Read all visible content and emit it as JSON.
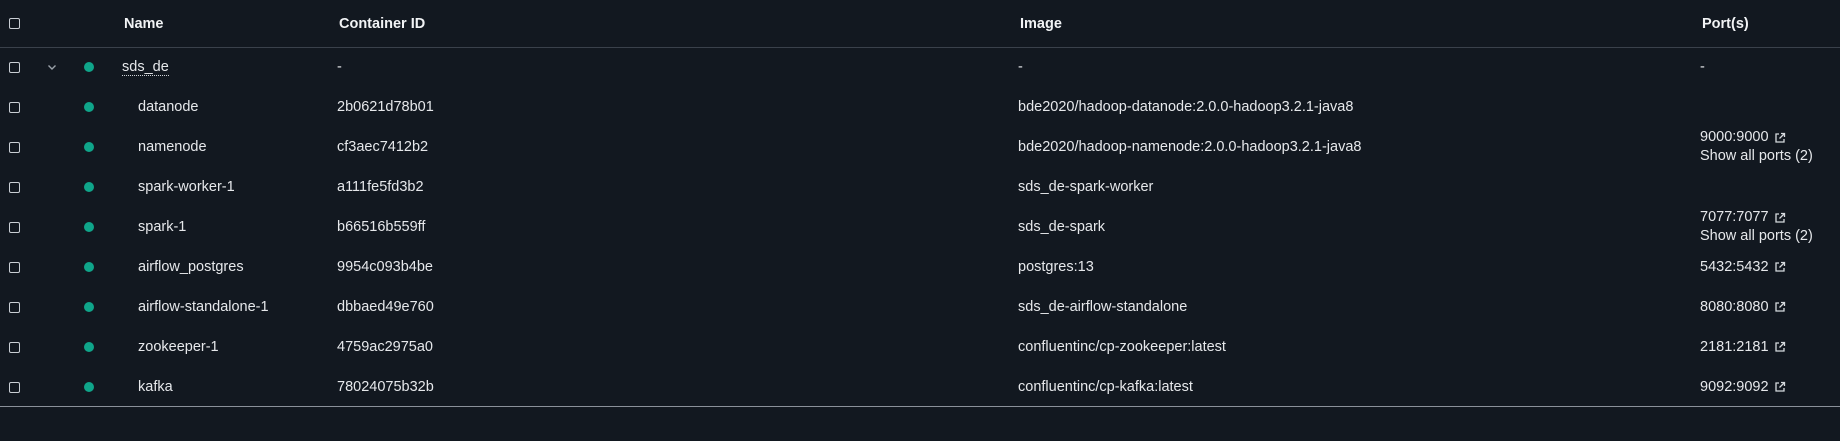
{
  "columns": {
    "name": "Name",
    "container_id": "Container ID",
    "image": "Image",
    "ports": "Port(s)"
  },
  "group": {
    "name": "sds_de",
    "container_id": "-",
    "image": "-",
    "ports": "-"
  },
  "rows": [
    {
      "name": "datanode",
      "container_id": "2b0621d78b01",
      "image": "bde2020/hadoop-datanode:2.0.0-hadoop3.2.1-java8",
      "port": "",
      "show_all": ""
    },
    {
      "name": "namenode",
      "container_id": "cf3aec7412b2",
      "image": "bde2020/hadoop-namenode:2.0.0-hadoop3.2.1-java8",
      "port": "9000:9000",
      "show_all": "Show all ports (2)"
    },
    {
      "name": "spark-worker-1",
      "container_id": "a111fe5fd3b2",
      "image": "sds_de-spark-worker",
      "port": "",
      "show_all": ""
    },
    {
      "name": "spark-1",
      "container_id": "b66516b559ff",
      "image": "sds_de-spark",
      "port": "7077:7077",
      "show_all": "Show all ports (2)"
    },
    {
      "name": "airflow_postgres",
      "container_id": "9954c093b4be",
      "image": "postgres:13",
      "port": "5432:5432",
      "show_all": ""
    },
    {
      "name": "airflow-standalone-1",
      "container_id": "dbbaed49e760",
      "image": "sds_de-airflow-standalone",
      "port": "8080:8080",
      "show_all": ""
    },
    {
      "name": "zookeeper-1",
      "container_id": "4759ac2975a0",
      "image": "confluentinc/cp-zookeeper:latest",
      "port": "2181:2181",
      "show_all": ""
    },
    {
      "name": "kafka",
      "container_id": "78024075b32b",
      "image": "confluentinc/cp-kafka:latest",
      "port": "9092:9092",
      "show_all": ""
    }
  ],
  "colors": {
    "background": "#121820",
    "status_running": "#0fa58a",
    "text": "#e6e8eb"
  }
}
